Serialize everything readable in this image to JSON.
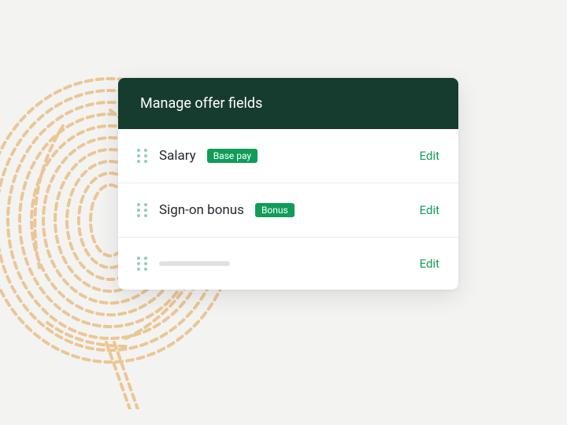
{
  "colors": {
    "header_bg": "#163b2f",
    "accent": "#0f9d58",
    "dot": "#8fd0b6"
  },
  "card": {
    "title": "Manage offer fields",
    "edit_label": "Edit",
    "rows": [
      {
        "name": "Salary",
        "badge": "Base pay",
        "has_name": true
      },
      {
        "name": "Sign-on bonus",
        "badge": "Bonus",
        "has_name": true
      },
      {
        "name": "",
        "badge": "",
        "has_name": false
      }
    ]
  }
}
